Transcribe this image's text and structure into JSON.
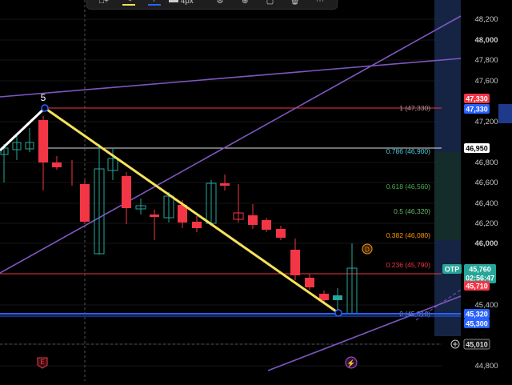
{
  "colors": {
    "background": "#000000",
    "up": "#26a69a",
    "down": "#f23645",
    "trendline": "#f5e25a",
    "channel": "#7e57c2",
    "price_line": "#2962ff",
    "fib_level": "#f23645"
  },
  "toolbar": {
    "items": [
      {
        "icon": "shape-plus-icon",
        "label": ""
      },
      {
        "icon": "pencil-icon",
        "label": ""
      },
      {
        "icon": "line-style-icon",
        "label": ""
      },
      {
        "icon": "line-width-icon",
        "label": "4px"
      },
      {
        "icon": "settings-icon",
        "label": ""
      },
      {
        "icon": "text-plus-icon",
        "label": ""
      },
      {
        "icon": "lock-icon",
        "label": ""
      },
      {
        "icon": "trash-icon",
        "label": ""
      },
      {
        "icon": "more-icon",
        "label": ""
      }
    ]
  },
  "wave_label": "5",
  "price_axis": {
    "ticks": [
      "48,200",
      "48,000",
      "47,800",
      "47,600",
      "47,200",
      "46,800",
      "46,600",
      "46,400",
      "46,200",
      "46,000",
      "45,400",
      "45,010",
      "44,800"
    ],
    "badges": [
      {
        "label": "47,330",
        "kind": "red"
      },
      {
        "label": "47,330",
        "kind": "blue"
      },
      {
        "label": "46,950",
        "kind": "dark"
      },
      {
        "label": "45,760",
        "kind": "green"
      },
      {
        "label": "02:56:47",
        "kind": "green"
      },
      {
        "label": "45,710",
        "kind": "red"
      },
      {
        "label": "45,320",
        "kind": "blue"
      },
      {
        "label": "45,300",
        "kind": "blue"
      },
      {
        "label": "45,010",
        "kind": "outline"
      }
    ],
    "otp_label": "OTP"
  },
  "fib_levels": [
    {
      "ratio": "1",
      "price": "47,330",
      "label": "1 (47,330)",
      "color": "#9e9e9e"
    },
    {
      "ratio": "0.786",
      "price": "46,900",
      "label": "0.786 (46,900)",
      "color": "#4dd0e1"
    },
    {
      "ratio": "0.618",
      "price": "46,560",
      "label": "0.618 (46,560)",
      "color": "#4caf50"
    },
    {
      "ratio": "0.5",
      "price": "46,320",
      "label": "0.5 (46,320)",
      "color": "#66bb6a"
    },
    {
      "ratio": "0.382",
      "price": "46,080",
      "label": "0.382 (46,080)",
      "color": "#ff9800"
    },
    {
      "ratio": "0.236",
      "price": "45,790",
      "label": "0.236 (45,790)",
      "color": "#f23645"
    },
    {
      "ratio": "0",
      "price": "45,310",
      "label": "0 (45,310)",
      "color": "#9e9e9e"
    }
  ],
  "markers": {
    "dividend": "D",
    "earnings": "E",
    "flash": "⚡"
  }
}
